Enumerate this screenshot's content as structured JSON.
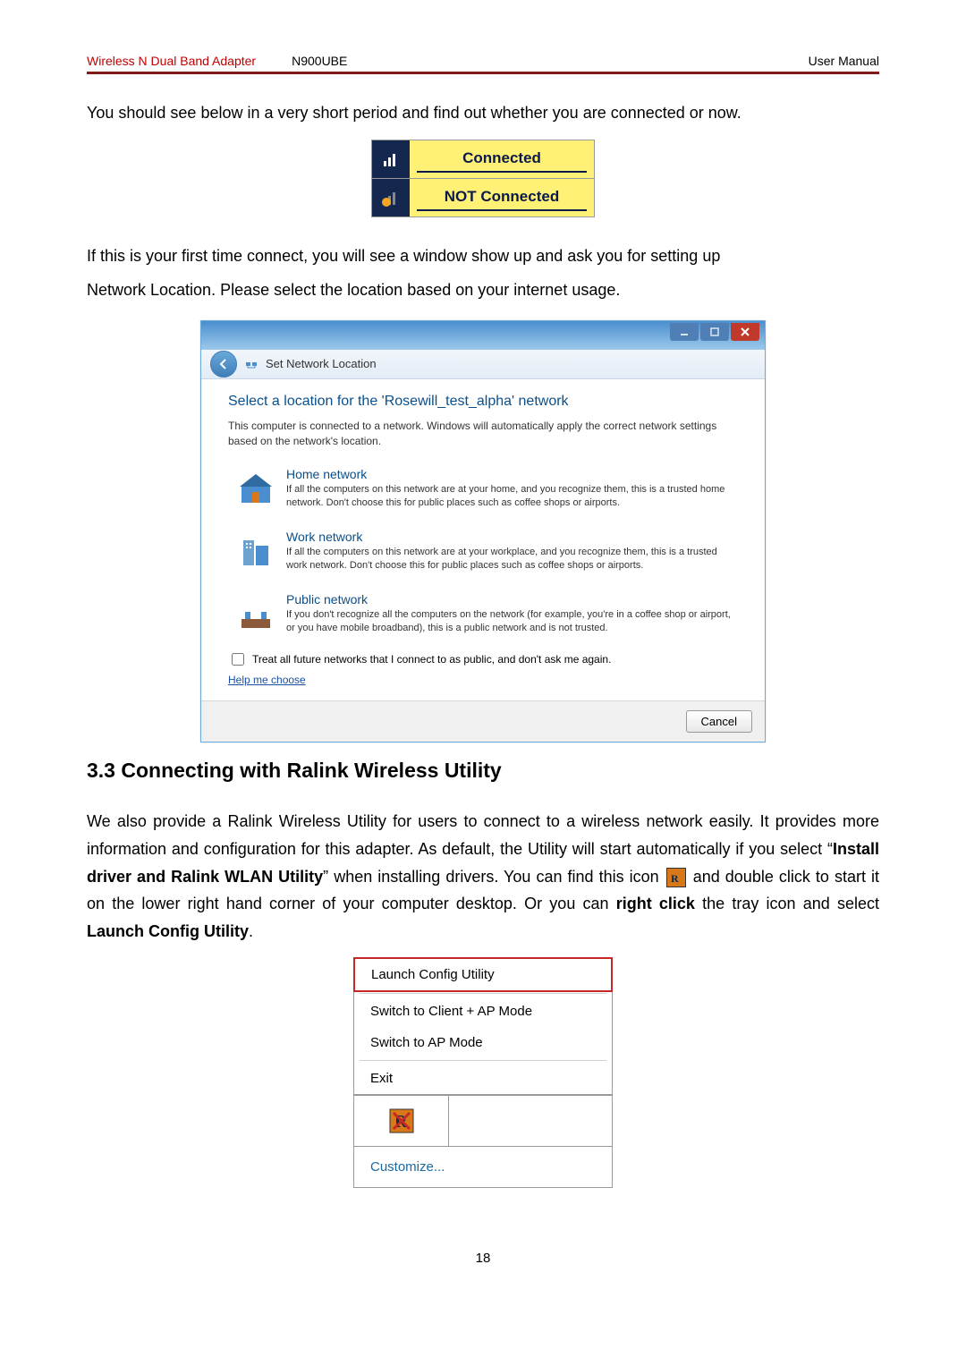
{
  "header": {
    "product_line": "Wireless N Dual Band Adapter",
    "model": "N900UBE",
    "doc_type": "User Manual"
  },
  "intro1": "You should see below in a very short period and find out whether you are connected or now.",
  "status": {
    "connected": "Connected",
    "not_connected": "NOT Connected"
  },
  "intro2a": "If this is your first time connect, you will see a window show up and ask you for setting up",
  "intro2b": "Network Location. Please select the location based on your internet usage.",
  "dialog": {
    "title": "Set Network Location",
    "heading": "Select a location for the 'Rosewill_test_alpha' network",
    "subtext": "This computer is connected to a network. Windows will automatically apply the correct network settings based on the network's location.",
    "options": [
      {
        "title": "Home network",
        "desc": "If all the computers on this network are at your home, and you recognize them, this is a trusted home network.  Don't choose this for public places such as coffee shops or airports."
      },
      {
        "title": "Work network",
        "desc": "If all the computers on this network are at your workplace, and you recognize them, this is a trusted work network.  Don't choose this for public places such as coffee shops or airports."
      },
      {
        "title": "Public network",
        "desc": "If you don't recognize all the computers on the network (for example, you're in a coffee shop or airport, or you have mobile broadband), this is a public network and is not trusted."
      }
    ],
    "checkbox": "Treat all future networks that I connect to as public, and don't ask me again.",
    "help_link": "Help me choose",
    "cancel": "Cancel"
  },
  "section": {
    "heading": "3.3 Connecting with Ralink Wireless Utility",
    "p1a": "We also provide a Ralink Wireless Utility for users to connect to a wireless network easily. It provides more information and configuration for this adapter. As default, the Utility will start automatically if you select “",
    "p1b_bold": "Install driver and Ralink WLAN Utility",
    "p1c": "” when installing drivers. You can find this icon ",
    "p1d": " and double click to start it on the lower right hand corner of your computer desktop. Or you can ",
    "p1e_bold": "right click",
    "p1f": " the tray icon and select ",
    "p1g_bold": "Launch Config Utility",
    "p1h": "."
  },
  "context_menu": {
    "launch": "Launch Config Utility",
    "switch_client_ap": "Switch to Client + AP Mode",
    "switch_ap": "Switch to AP Mode",
    "exit": "Exit",
    "customize": "Customize..."
  },
  "page_number": "18"
}
